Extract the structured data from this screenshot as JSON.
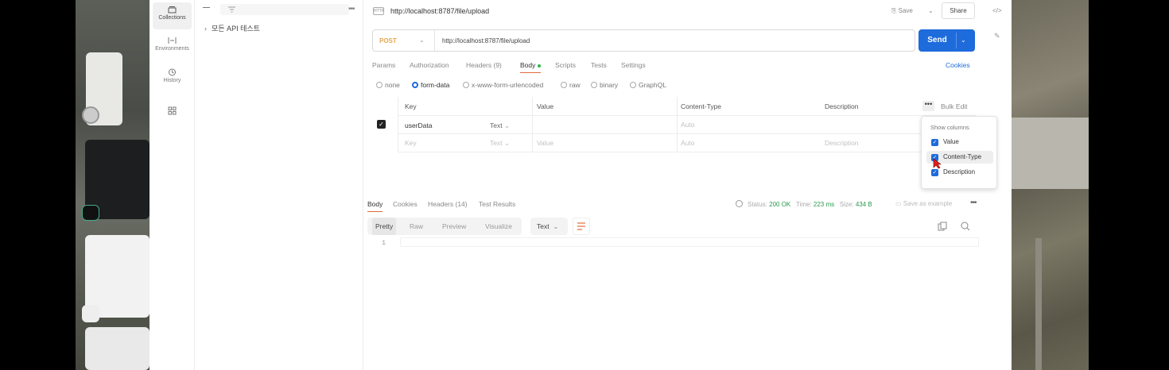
{
  "rail": {
    "items": [
      {
        "label": "Collections",
        "active": true
      },
      {
        "label": "Environments",
        "active": false
      },
      {
        "label": "History",
        "active": false
      }
    ]
  },
  "sidebar": {
    "collection_name": "모든 API 테스트"
  },
  "tab": {
    "title": "http://localhost:8787/file/upload",
    "save_label": "Save",
    "share_label": "Share"
  },
  "request": {
    "method": "POST",
    "url": "http://localhost:8787/file/upload",
    "send_label": "Send",
    "tabs": [
      "Params",
      "Authorization",
      "Headers (9)",
      "Body",
      "Scripts",
      "Tests",
      "Settings"
    ],
    "active_tab": "Body",
    "cookies_label": "Cookies",
    "body_types": [
      "none",
      "form-data",
      "x-www-form-urlencoded",
      "raw",
      "binary",
      "GraphQL"
    ],
    "selected_body_type": "form-data"
  },
  "kv_table": {
    "headers": {
      "key": "Key",
      "value": "Value",
      "content_type": "Content-Type",
      "description": "Description",
      "bulk_edit": "Bulk Edit"
    },
    "rows": [
      {
        "key": "userData",
        "type": "Text",
        "value": "",
        "content_type": "Auto",
        "description": "",
        "checked": true
      }
    ],
    "placeholder_row": {
      "key": "Key",
      "type": "Text",
      "value": "Value",
      "content_type": "Auto",
      "description": "Description"
    }
  },
  "columns_popup": {
    "title": "Show columns",
    "options": [
      {
        "label": "Value",
        "checked": true
      },
      {
        "label": "Content-Type",
        "checked": true
      },
      {
        "label": "Description",
        "checked": true
      }
    ]
  },
  "response": {
    "tabs": [
      "Body",
      "Cookies",
      "Headers (14)",
      "Test Results"
    ],
    "active_tab": "Body",
    "status_label": "Status:",
    "status_value": "200 OK",
    "time_label": "Time:",
    "time_value": "223 ms",
    "size_label": "Size:",
    "size_value": "434 B",
    "save_example": "Save as example",
    "formats": [
      "Pretty",
      "Raw",
      "Preview",
      "Visualize"
    ],
    "active_format": "Pretty",
    "text_type": "Text",
    "line_number": "1"
  },
  "colors": {
    "accent": "#1e6bdc",
    "method": "#e5a84e",
    "active_tab_underline": "#e26b3a",
    "status_ok": "#2a9a4d"
  }
}
